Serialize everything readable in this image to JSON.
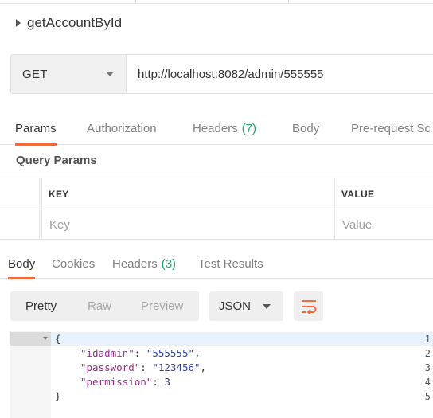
{
  "request": {
    "name": "getAccountById",
    "method": "GET",
    "url": "http://localhost:8082/admin/555555"
  },
  "request_tabs": [
    {
      "label": "Params",
      "active": true
    },
    {
      "label": "Authorization"
    },
    {
      "label": "Headers",
      "count": "(7)"
    },
    {
      "label": "Body"
    },
    {
      "label": "Pre-request Sc"
    }
  ],
  "query_params": {
    "title": "Query Params",
    "columns": [
      "KEY",
      "VALUE"
    ],
    "placeholders": {
      "key": "Key",
      "value": "Value"
    }
  },
  "response_tabs": [
    {
      "label": "Body",
      "active": true
    },
    {
      "label": "Cookies"
    },
    {
      "label": "Headers",
      "count": "(3)"
    },
    {
      "label": "Test Results"
    }
  ],
  "response_view": {
    "modes": [
      "Pretty",
      "Raw",
      "Preview"
    ],
    "active_mode": "Pretty",
    "format": "JSON",
    "wrap_icon": "wrap-lines-icon"
  },
  "response_body": {
    "line_numbers": [
      "1",
      "2",
      "3",
      "4",
      "5"
    ],
    "lines": [
      {
        "text": "{"
      },
      {
        "key": "\"idadmin\"",
        "sep": ": ",
        "value": "\"555555\"",
        "end": ","
      },
      {
        "key": "\"password\"",
        "sep": ": ",
        "value": "\"123456\"",
        "end": ","
      },
      {
        "key": "\"permission\"",
        "sep": ": ",
        "value": "3",
        "end": ""
      },
      {
        "text": "}"
      }
    ]
  },
  "colors": {
    "accent": "#f26b3a",
    "count_green": "#26a069",
    "json_key": "#9c2a8f",
    "json_string": "#2f42a6"
  }
}
